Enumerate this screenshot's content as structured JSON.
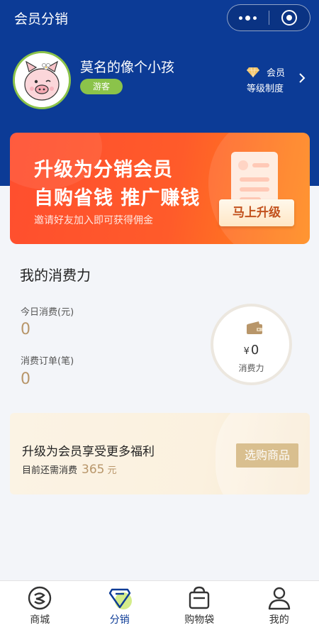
{
  "nav": {
    "title": "会员分销"
  },
  "user": {
    "name": "莫名的像个小孩",
    "badge": "游客"
  },
  "level": {
    "member": "会员",
    "system": "等级制度"
  },
  "promo": {
    "title": "升级为分销会员",
    "subtitle": "自购省钱 推广赚钱",
    "note": "邀请好友加入即可获得佣金",
    "button": "马上升级"
  },
  "consumption": {
    "title": "我的消费力",
    "today_label": "今日消费(元)",
    "today_value": "0",
    "orders_label": "消费订单(笔)",
    "orders_value": "0",
    "currency": "¥",
    "power_value": "0",
    "power_label": "消费力"
  },
  "benefit": {
    "title": "升级为会员享受更多福利",
    "needed_prefix": "目前还需消费",
    "needed_value": "365",
    "needed_unit": "元",
    "button": "选购商品"
  },
  "tabs": [
    {
      "label": "商城",
      "icon": "mall-icon"
    },
    {
      "label": "分销",
      "icon": "distribution-icon",
      "active": true
    },
    {
      "label": "购物袋",
      "icon": "shopping-bag-icon"
    },
    {
      "label": "我的",
      "icon": "profile-icon"
    }
  ],
  "colors": {
    "header": "#0c3b96",
    "accent_green": "#8bc34a",
    "promo_orange": "#ff5b2a",
    "gold": "#b8966a"
  }
}
